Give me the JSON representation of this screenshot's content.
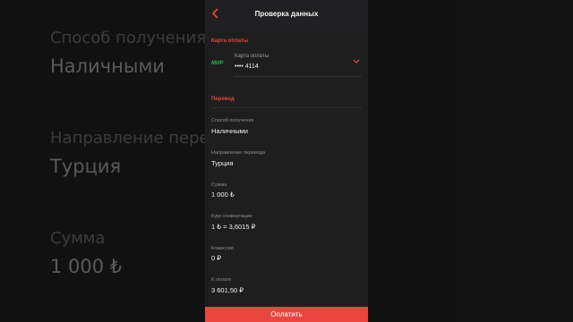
{
  "background": {
    "fields": [
      {
        "label": "Способ получения",
        "value": "Наличными"
      },
      {
        "label": "Направление перевода",
        "value": "Турция"
      },
      {
        "label": "Сумма",
        "value": "1 000 ₺"
      }
    ]
  },
  "header": {
    "title": "Проверка данных",
    "back_icon": "chevron-left-icon"
  },
  "payment_section": {
    "heading": "Карта оплаты",
    "card_brand": "МИР",
    "card_label": "Карта оплаты",
    "card_number": "•••• 4114"
  },
  "transfer_section": {
    "heading": "Перевод",
    "fields": [
      {
        "label": "Способ получения",
        "value": "Наличными"
      },
      {
        "label": "Направление перевода",
        "value": "Турция"
      },
      {
        "label": "Сумма",
        "value": "1 000 ₺"
      },
      {
        "label": "Курс конвертации",
        "value": "1 ₺ = 3,6015 ₽"
      },
      {
        "label": "Комиссия",
        "value": "0 ₽"
      },
      {
        "label": "К оплате",
        "value": "3 601,50 ₽"
      }
    ]
  },
  "pay_button": {
    "label": "Оплатить"
  },
  "colors": {
    "accent": "#e8463f",
    "mir_green": "#2fb24a",
    "bg": "#1e1e1f"
  }
}
